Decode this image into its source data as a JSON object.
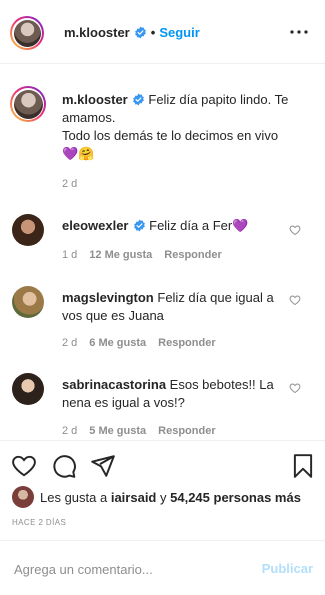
{
  "header": {
    "username": "m.klooster",
    "separator": "•",
    "follow_label": "Seguir",
    "more_icon": "more-horizontal-icon"
  },
  "caption": {
    "username": "m.klooster",
    "line1": "Feliz día papito lindo. Te amamos.",
    "line2": "Todo los demás te lo decimos en vivo",
    "emojis": "💜🤗",
    "time": "2 d"
  },
  "comments": [
    {
      "username": "eleowexler",
      "verified": true,
      "text": "Feliz día a Fer💜",
      "time": "1 d",
      "likes": "12 Me gusta",
      "reply": "Responder"
    },
    {
      "username": "magslevington",
      "verified": false,
      "text": "Feliz día que igual a vos que es Juana",
      "time": "2 d",
      "likes": "6 Me gusta",
      "reply": "Responder"
    },
    {
      "username": "sabrinacastorina",
      "verified": false,
      "text": "Esos bebotes!! La nena es igual a vos!?",
      "time": "2 d",
      "likes": "5 Me gusta",
      "reply": "Responder"
    }
  ],
  "likes": {
    "prefix": "Les gusta a",
    "user": "iairsaid",
    "middle": "y",
    "count": "54,245 personas más"
  },
  "post_time": "HACE 2 DÍAS",
  "comment_box": {
    "placeholder": "Agrega un comentario...",
    "publish_label": "Publicar"
  },
  "colors": {
    "link": "#0095f6",
    "muted": "#8e8e8e",
    "publish_disabled": "#b2dffc",
    "verified": "#3897f0"
  }
}
